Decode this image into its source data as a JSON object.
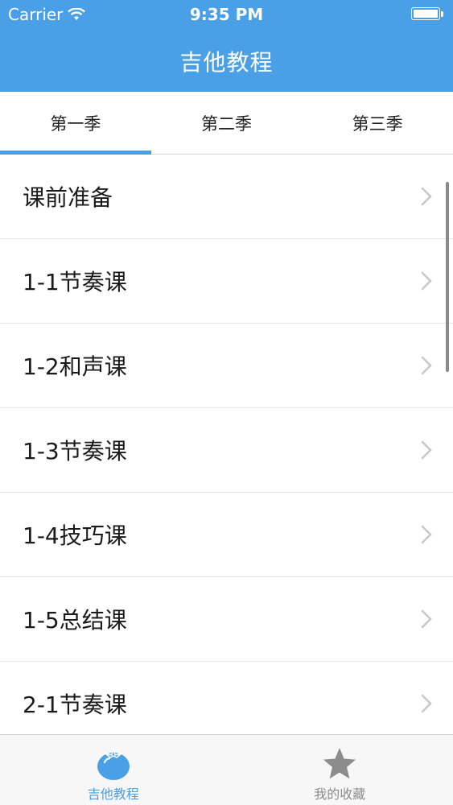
{
  "status_bar": {
    "carrier": "Carrier",
    "time": "9:35 PM",
    "icons": [
      "wifi-icon",
      "battery-icon"
    ]
  },
  "nav": {
    "title": "吉他教程"
  },
  "tabs": [
    {
      "label": "第一季",
      "active": true
    },
    {
      "label": "第二季",
      "active": false
    },
    {
      "label": "第三季",
      "active": false
    }
  ],
  "lessons": [
    {
      "label": "课前准备"
    },
    {
      "label": "1-1节奏课"
    },
    {
      "label": "1-2和声课"
    },
    {
      "label": "1-3节奏课"
    },
    {
      "label": "1-4技巧课"
    },
    {
      "label": "1-5总结课"
    },
    {
      "label": "2-1节奏课"
    }
  ],
  "tabbar": {
    "items": [
      {
        "label": "吉他教程",
        "icon": "tomato-icon",
        "active": true
      },
      {
        "label": "我的收藏",
        "icon": "star-icon",
        "active": false
      }
    ]
  },
  "colors": {
    "accent": "#4aa0e6",
    "inactive": "#8c8c8c",
    "chevron": "#c7c7cc"
  }
}
